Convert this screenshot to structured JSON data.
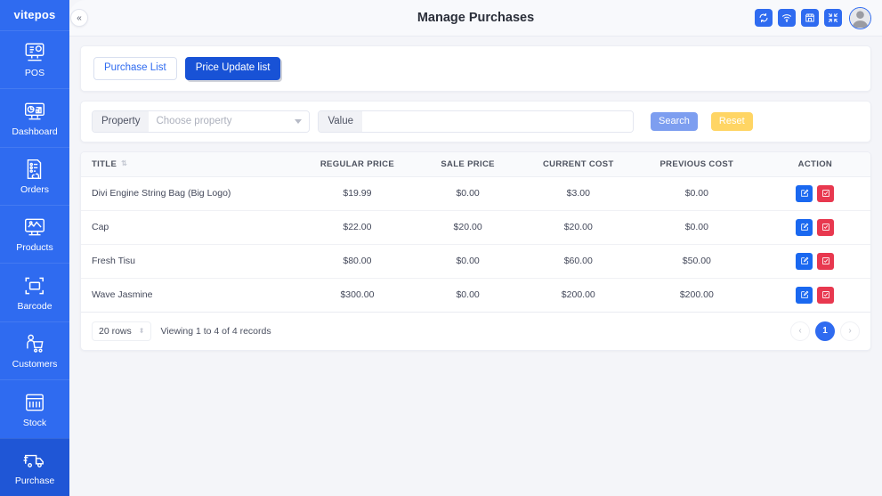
{
  "brand": {
    "name": "vitepos"
  },
  "sidebar": {
    "items": [
      {
        "label": "POS",
        "icon": "pos-icon",
        "active": false
      },
      {
        "label": "Dashboard",
        "icon": "dashboard-icon",
        "active": false
      },
      {
        "label": "Orders",
        "icon": "orders-icon",
        "active": false
      },
      {
        "label": "Products",
        "icon": "products-icon",
        "active": false
      },
      {
        "label": "Barcode",
        "icon": "barcode-icon",
        "active": false
      },
      {
        "label": "Customers",
        "icon": "customers-icon",
        "active": false
      },
      {
        "label": "Stock",
        "icon": "stock-icon",
        "active": false
      },
      {
        "label": "Purchase",
        "icon": "purchase-icon",
        "active": true
      }
    ]
  },
  "header": {
    "title": "Manage Purchases",
    "collapse_glyph": "«",
    "actions": [
      {
        "name": "sync-icon"
      },
      {
        "name": "wifi-icon"
      },
      {
        "name": "store-icon"
      },
      {
        "name": "fullscreen-icon"
      }
    ]
  },
  "tabs": [
    {
      "label": "Purchase List",
      "active": false
    },
    {
      "label": "Price Update list",
      "active": true
    }
  ],
  "filter": {
    "property_label": "Property",
    "property_placeholder": "Choose property",
    "value_label": "Value",
    "value_text": "",
    "value_placeholder": "",
    "search_label": "Search",
    "reset_label": "Reset"
  },
  "table": {
    "columns": [
      "TITLE",
      "REGULAR PRICE",
      "SALE PRICE",
      "CURRENT COST",
      "PREVIOUS COST",
      "ACTION"
    ],
    "sort_glyph": "⇅",
    "rows": [
      {
        "title": "Divi Engine String Bag (Big Logo)",
        "regular_price": "$19.99",
        "sale_price": "$0.00",
        "current_cost": "$3.00",
        "previous_cost": "$0.00"
      },
      {
        "title": "Cap",
        "regular_price": "$22.00",
        "sale_price": "$20.00",
        "current_cost": "$20.00",
        "previous_cost": "$0.00"
      },
      {
        "title": "Fresh Tisu",
        "regular_price": "$80.00",
        "sale_price": "$0.00",
        "current_cost": "$60.00",
        "previous_cost": "$50.00"
      },
      {
        "title": "Wave Jasmine",
        "regular_price": "$300.00",
        "sale_price": "$0.00",
        "current_cost": "$200.00",
        "previous_cost": "$200.00"
      }
    ]
  },
  "footer": {
    "rows_per_page": "20 rows",
    "viewing_text": "Viewing 1 to 4 of 4 records",
    "prev_glyph": "‹",
    "next_glyph": "›",
    "current_page": "1"
  },
  "colors": {
    "sidebar": "#2f6bf0",
    "sidebar_active": "#1f56d6",
    "accent": "#1852d6",
    "edit": "#1a68f0",
    "delete": "#e8384f",
    "reset": "#ffd564",
    "search": "#7d9ef0",
    "page_bg": "#f4f5f9"
  }
}
